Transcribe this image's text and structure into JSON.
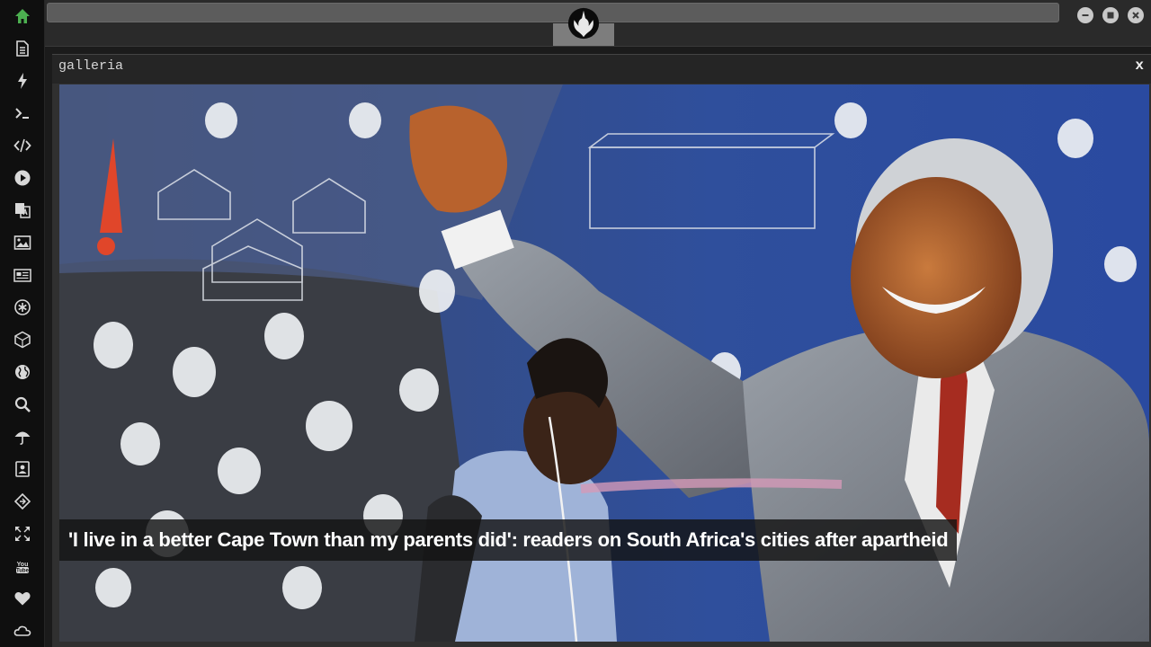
{
  "sidebar": {
    "items": [
      {
        "icon": "home-icon"
      },
      {
        "icon": "document-icon"
      },
      {
        "icon": "lightning-icon"
      },
      {
        "icon": "terminal-icon"
      },
      {
        "icon": "code-icon"
      },
      {
        "icon": "play-icon"
      },
      {
        "icon": "translate-icon"
      },
      {
        "icon": "image-icon"
      },
      {
        "icon": "newspaper-icon"
      },
      {
        "icon": "asterisk-icon"
      },
      {
        "icon": "cube-icon"
      },
      {
        "icon": "globe-icon"
      },
      {
        "icon": "search-icon"
      },
      {
        "icon": "umbrella-icon"
      },
      {
        "icon": "contact-icon"
      },
      {
        "icon": "plugin-icon"
      },
      {
        "icon": "expand-icon"
      },
      {
        "icon": "youtube-icon"
      },
      {
        "icon": "heart-icon"
      },
      {
        "icon": "cloud-icon"
      }
    ],
    "active_color": "#4caf50",
    "icon_color": "#d8d8d8"
  },
  "topbar": {
    "emblem": "rebel-alliance-icon",
    "window_controls": [
      "minimize-icon",
      "maximize-icon",
      "close-icon"
    ]
  },
  "panel": {
    "title": "galleria",
    "close_label": "x"
  },
  "gallery": {
    "caption": "'I live in a better Cape Town than my parents did': readers on South Africa's cities after apartheid"
  }
}
